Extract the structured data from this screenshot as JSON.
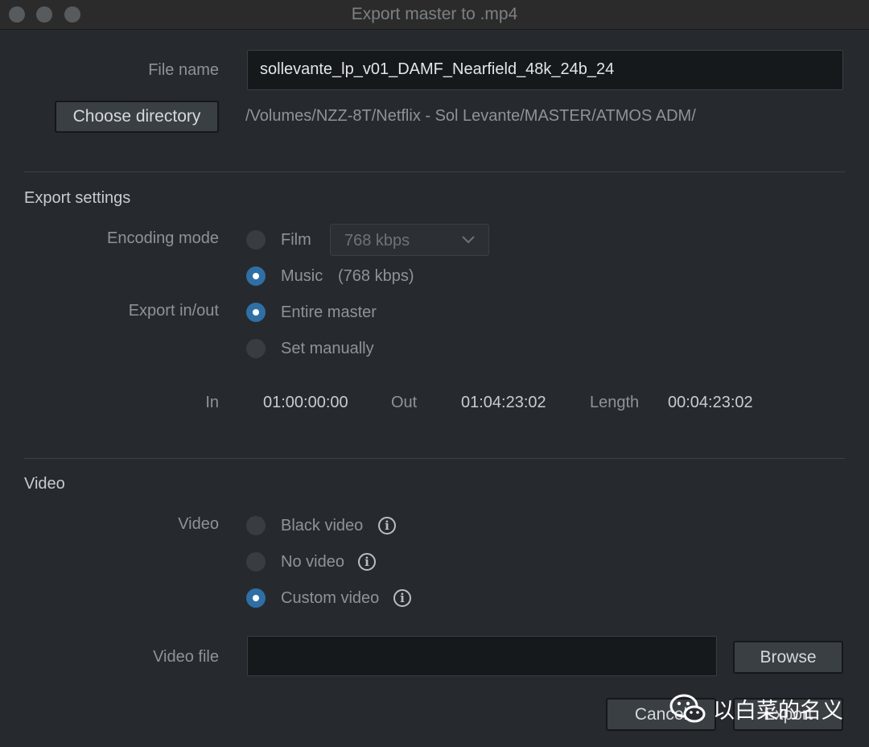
{
  "window": {
    "title": "Export master to .mp4"
  },
  "file": {
    "name_label": "File name",
    "name_value": "sollevante_lp_v01_DAMF_Nearfield_48k_24b_24",
    "choose_dir_label": "Choose directory",
    "directory_path": "/Volumes/NZZ-8T/Netflix - Sol Levante/MASTER/ATMOS ADM/"
  },
  "export_settings": {
    "section_title": "Export settings",
    "encoding_mode_label": "Encoding mode",
    "film_label": "Film",
    "film_bitrate": "768 kbps",
    "music_label": "Music",
    "music_bitrate": "(768 kbps)",
    "selected_encoding": "Music",
    "inout_label": "Export in/out",
    "entire_label": "Entire master",
    "manual_label": "Set manually",
    "selected_inout": "Entire master",
    "in_label": "In",
    "in_value": "01:00:00:00",
    "out_label": "Out",
    "out_value": "01:04:23:02",
    "length_label": "Length",
    "length_value": "00:04:23:02"
  },
  "video": {
    "section_title": "Video",
    "video_label": "Video",
    "black_label": "Black video",
    "none_label": "No video",
    "custom_label": "Custom video",
    "selected": "Custom video",
    "file_label": "Video file",
    "file_value": "",
    "browse_label": "Browse"
  },
  "footer": {
    "cancel_label": "Cancel",
    "export_label": "Export"
  },
  "watermark": {
    "text": "以白菜的名义"
  },
  "icons": {
    "info": "info-icon",
    "dropdown": "chevron-down-icon",
    "watermark": "wechat-icon"
  },
  "colors": {
    "accent": "#2f6fa6",
    "background": "#262a2e"
  }
}
